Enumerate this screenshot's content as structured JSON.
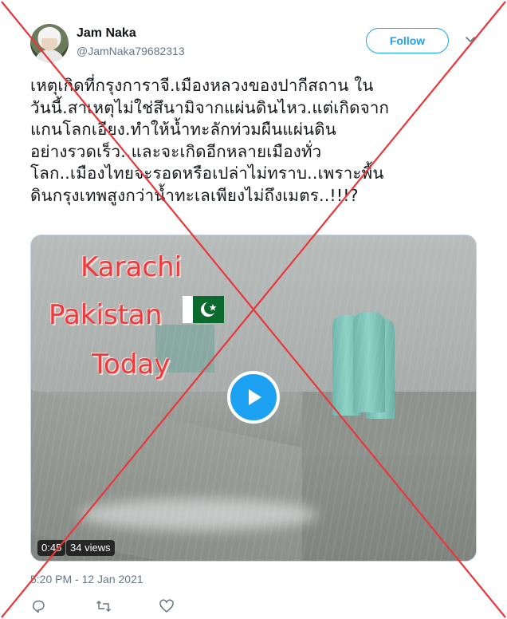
{
  "tweet": {
    "display_name": "Jam Naka",
    "handle": "@JamNaka79682313",
    "follow_label": "Follow",
    "text": "เหตุเกิดที่กรุงการาจี.เมืองหลวงของปากีสถาน ใน\nวันนี้.สาเหตุไม่ใช่สึนามิจากแผ่นดินไหว.แต่เกิดจาก\nแกนโลกเอียง.ทำให้น้ำทะลักท่วมผืนแผ่นดิน\nอย่างรวดเร็ว..และจะเกิดอีกหลายเมืองทั่ว\nโลก..เมืองไทยจะรอดหรือเปล่าไม่ทราบ..เพราะพื้น\nดินกรุงเทพสูงกว่าน้ำทะเลเพียงไม่ถึงเมตร..!!!?",
    "timestamp": "5:20 PM - 12 Jan 2021"
  },
  "video": {
    "overlay_lines": [
      "Karachi",
      "Pakistan",
      "Today"
    ],
    "duration": "0:45",
    "views": "34 views"
  },
  "icons": {
    "caret": "chevron-down-icon",
    "reply": "reply-icon",
    "retweet": "retweet-icon",
    "like": "heart-icon",
    "play": "play-icon",
    "flag": "pakistan-flag-icon"
  },
  "colors": {
    "accent": "#1da1f2",
    "cross": "#e8373b",
    "overlay_text": "#ee3a3a",
    "muted": "#657786"
  }
}
